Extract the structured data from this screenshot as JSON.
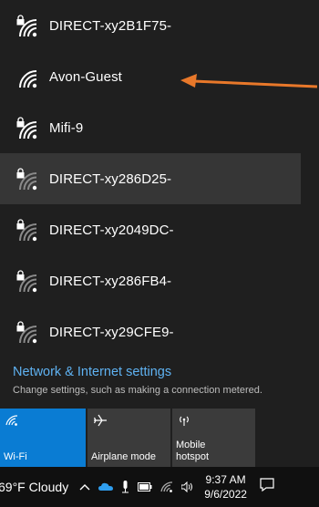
{
  "networks": [
    {
      "name": "DIRECT-xy2B1F75-",
      "secured": true,
      "selected": false,
      "strong": true
    },
    {
      "name": "Avon-Guest",
      "secured": false,
      "selected": false,
      "strong": true
    },
    {
      "name": "Mifi-9",
      "secured": true,
      "selected": false,
      "strong": true
    },
    {
      "name": "DIRECT-xy286D25-",
      "secured": true,
      "selected": true,
      "strong": false
    },
    {
      "name": "DIRECT-xy2049DC-",
      "secured": true,
      "selected": false,
      "strong": false
    },
    {
      "name": "DIRECT-xy286FB4-",
      "secured": true,
      "selected": false,
      "strong": false
    },
    {
      "name": "DIRECT-xy29CFE9-",
      "secured": true,
      "selected": false,
      "strong": false
    }
  ],
  "settings": {
    "title": "Network & Internet settings",
    "subtitle": "Change settings, such as making a connection metered."
  },
  "tiles": [
    {
      "label": "Wi-Fi",
      "icon": "wifi-icon",
      "active": true
    },
    {
      "label": "Airplane mode",
      "icon": "airplane-icon",
      "active": false
    },
    {
      "label": "Mobile\nhotspot",
      "icon": "hotspot-icon",
      "active": false
    }
  ],
  "taskbar": {
    "weather": "69°F  Cloudy",
    "time": "9:37 AM",
    "date": "9/6/2022"
  },
  "colors": {
    "accent": "#0a7cd3",
    "link": "#5fb2f2",
    "arrow": "#e8782a"
  }
}
